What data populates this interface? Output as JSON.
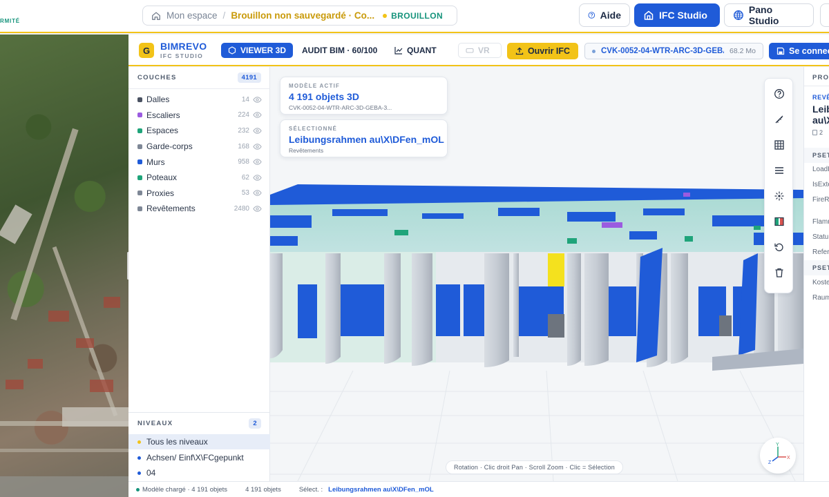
{
  "topbar": {
    "brand_fragment": "RMITÉ",
    "breadcrumb": {
      "home": "Mon espace",
      "separator": "/",
      "draft_title": "Brouillon non sauvegardé · Co...",
      "status": "BROUILLON"
    },
    "buttons": {
      "help": "Aide",
      "ifc_studio": "IFC Studio",
      "pano_studio": "Pano Studio"
    }
  },
  "app": {
    "logo_letter": "G",
    "name": "BIMREVO",
    "subtitle": "IFC STUDIO",
    "nav": {
      "viewer": "VIEWER 3D",
      "audit": "AUDIT BIM · 60/100",
      "quant": "QUANT",
      "vr": "VR"
    },
    "open_ifc": "Ouvrir IFC",
    "file": {
      "name": "CVK-0052-04-WTR-ARC-3D-GEBA-",
      "size": "68.2 Mo"
    },
    "save": "Se connec"
  },
  "layers": {
    "title": "COUCHES",
    "total": "4191",
    "items": [
      {
        "label": "Dalles",
        "count": "14",
        "color": "#4a5262"
      },
      {
        "label": "Escaliers",
        "count": "224",
        "color": "#9b5be0"
      },
      {
        "label": "Espaces",
        "count": "232",
        "color": "#1fa47a"
      },
      {
        "label": "Garde-corps",
        "count": "168",
        "color": "#7e8796"
      },
      {
        "label": "Murs",
        "count": "958",
        "color": "#1f5bd8"
      },
      {
        "label": "Poteaux",
        "count": "62",
        "color": "#1fa47a"
      },
      {
        "label": "Proxies",
        "count": "53",
        "color": "#7e8796"
      },
      {
        "label": "Revêtements",
        "count": "2480",
        "color": "#7e8796"
      }
    ]
  },
  "levels": {
    "title": "NIVEAUX",
    "count": "2",
    "items": [
      {
        "label": "Tous les niveaux",
        "color": "#f2c318",
        "active": true
      },
      {
        "label": "Achsen/ Einf\\X\\FCgepunkt",
        "color": "#1f5bd8",
        "active": false
      },
      {
        "label": "04",
        "color": "#1f5bd8",
        "active": false
      }
    ]
  },
  "viewport": {
    "active_model": {
      "caption": "MODÈLE ACTIF",
      "objects": "4 191 objets 3D",
      "file": "CVK-0052-04-WTR-ARC-3D-GEBA-3..."
    },
    "selected": {
      "caption": "SÉLECTIONNÉ",
      "name": "Leibungsrahmen au\\X\\DFen_mOL",
      "type": "Revêtements"
    },
    "hint": "Rotation · Clic droit Pan · Scroll Zoom · Clic = Sélection",
    "axes": {
      "x": "X",
      "y": "Y",
      "z": "Z"
    },
    "tools": [
      "help-icon",
      "measure-icon",
      "grid-icon",
      "list-icon",
      "explode-icon",
      "section-icon",
      "reset-icon",
      "delete-icon"
    ]
  },
  "properties": {
    "title": "PRO",
    "type": "REVÊ",
    "name_line1": "Leib",
    "name_line2": "au\\X",
    "copy_label": "2",
    "pset1": "PSET",
    "rows1": [
      "LoadB",
      "IsExte",
      "FireRa",
      "Flamm",
      "Statu",
      "Refer"
    ],
    "pset2": "PSET",
    "rows2": [
      "Koste",
      "Raum"
    ]
  },
  "status": {
    "loaded": "Modèle chargé · 4 191 objets",
    "count": "4 191 objets",
    "select_label": "Sélect. :",
    "select_value": "Leibungsrahmen au\\X\\DFen_mOL"
  }
}
